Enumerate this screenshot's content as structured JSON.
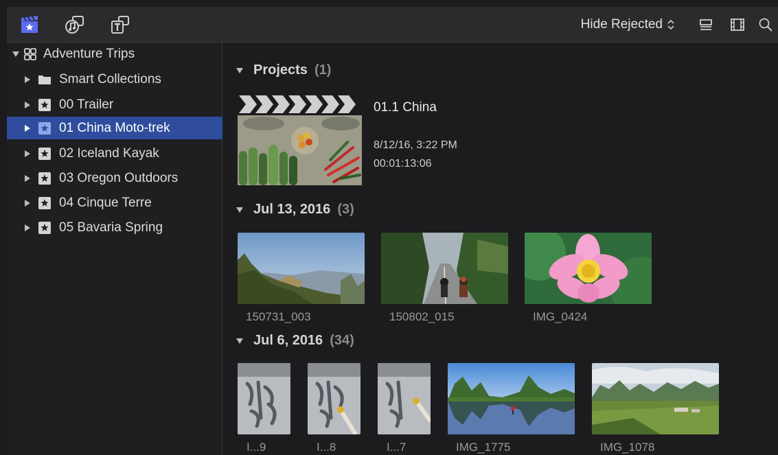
{
  "toolbar": {
    "filter_label": "Hide Rejected",
    "left_buttons": [
      {
        "name": "libraries-icon"
      },
      {
        "name": "photos-audio-icon"
      },
      {
        "name": "titles-generators-icon"
      }
    ],
    "right_icons": [
      "clip-appearance-icon",
      "filmstrip-icon",
      "search-icon"
    ]
  },
  "sidebar": {
    "items": [
      {
        "label": "Adventure Trips",
        "type": "library",
        "expanded": true
      },
      {
        "label": "Smart Collections",
        "type": "folder"
      },
      {
        "label": "00 Trailer",
        "type": "event"
      },
      {
        "label": "01 China Moto-trek",
        "type": "event",
        "selected": true
      },
      {
        "label": "02 Iceland Kayak",
        "type": "event"
      },
      {
        "label": "03 Oregon Outdoors",
        "type": "event"
      },
      {
        "label": "04 Cinque Terre",
        "type": "event"
      },
      {
        "label": "05 Bavaria Spring",
        "type": "event"
      }
    ]
  },
  "browser": {
    "sections": [
      {
        "title": "Projects",
        "count": "(1)"
      },
      {
        "title": "Jul 13, 2016",
        "count": "(3)"
      },
      {
        "title": "Jul 6, 2016",
        "count": "(34)"
      }
    ],
    "project": {
      "name": "01.1 China",
      "date": "8/12/16, 3:22 PM",
      "duration": "00:01:13:06"
    },
    "jul13_clips": [
      {
        "label": "150731_003"
      },
      {
        "label": "150802_015"
      },
      {
        "label": "IMG_0424"
      }
    ],
    "jul6_clips": [
      {
        "label": "I...9"
      },
      {
        "label": "I...8"
      },
      {
        "label": "I...7"
      },
      {
        "label": "IMG_1775"
      },
      {
        "label": "IMG_1078"
      }
    ]
  },
  "colors": {
    "selection": "#2f4d9c",
    "accent_icon": "#5b6cf0",
    "background": "#1c1c1e"
  }
}
